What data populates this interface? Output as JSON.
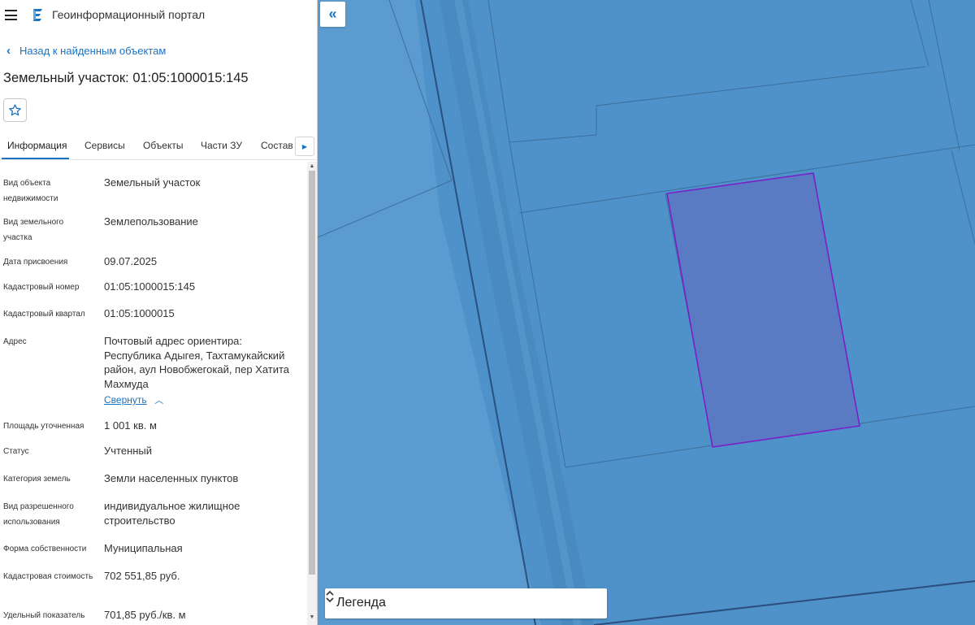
{
  "header": {
    "portal_title": "Геоинформационный портал"
  },
  "panel": {
    "back_link": "Назад к найденным объектам",
    "object_title": "Земельный участок: 01:05:1000015:145",
    "tabs": [
      {
        "label": "Информация",
        "active": true
      },
      {
        "label": "Сервисы"
      },
      {
        "label": "Объекты"
      },
      {
        "label": "Части ЗУ"
      },
      {
        "label": "Состав"
      }
    ],
    "attributes": [
      {
        "label": "Вид объекта недвижимости",
        "value": "Земельный участок"
      },
      {
        "label": "Вид земельного участка",
        "value": "Землепользование"
      },
      {
        "label": "Дата присвоения",
        "value": "09.07.2025"
      },
      {
        "label": "Кадастровый номер",
        "value": "01:05:1000015:145"
      },
      {
        "label": "Кадастровый квартал",
        "value": "01:05:1000015"
      },
      {
        "label": "Адрес",
        "value": "Почтовый адрес ориентира: Республика Адыгея, Тахтамукайский район, аул Новобжегокай, пер Хатита Махмуда",
        "collapse_label": "Свернуть"
      },
      {
        "label": "Площадь уточненная",
        "value": "1 001 кв. м"
      },
      {
        "label": "Статус",
        "value": "Учтенный"
      },
      {
        "label": "Категория земель",
        "value": "Земли населенных пунктов"
      },
      {
        "label": "Вид разрешенного использования",
        "value": "индивидуальное жилищное строительство"
      },
      {
        "label": "Форма собственности",
        "value": "Муниципальная"
      },
      {
        "label": "Кадастровая стоимость",
        "value": "702 551,85 руб."
      },
      {
        "label": "Удельный показатель",
        "value": "701,85 руб./кв. м"
      }
    ]
  },
  "map": {
    "collapse_icon": "«",
    "legend_label": "Легенда",
    "colors": {
      "background": "#4e92c9",
      "parcel_fill": "#5a7ac4",
      "parcel_stroke": "#7b1fc8",
      "boundary": "#3a6a98"
    }
  },
  "icons": {
    "menu": "hamburger-icon",
    "logo": "portal-logo-icon",
    "back": "chevron-left-icon",
    "favorite": "star-outline-icon",
    "tabs_scroll": "chevron-right-icon",
    "collapse": "double-chevron-left-icon",
    "legend_toggle": "unfold-icon"
  }
}
